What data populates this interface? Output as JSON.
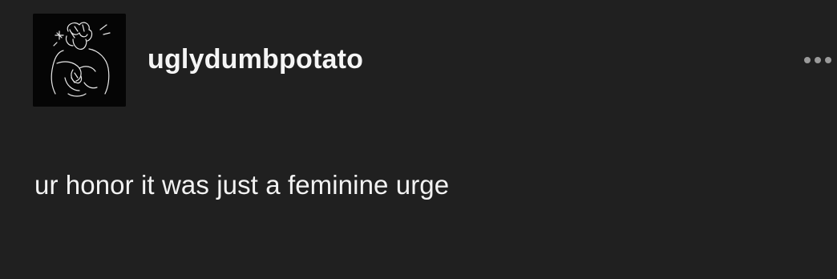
{
  "post": {
    "author": {
      "username": "uglydumbpotato",
      "avatar_icon": "line-drawing-avatar-icon"
    },
    "more_icon": "ellipsis-icon",
    "body_text": "ur honor it was just a feminine urge"
  },
  "colors": {
    "background": "#202020",
    "text": "#f2f2f2",
    "muted_icon": "#9a9a9a"
  }
}
